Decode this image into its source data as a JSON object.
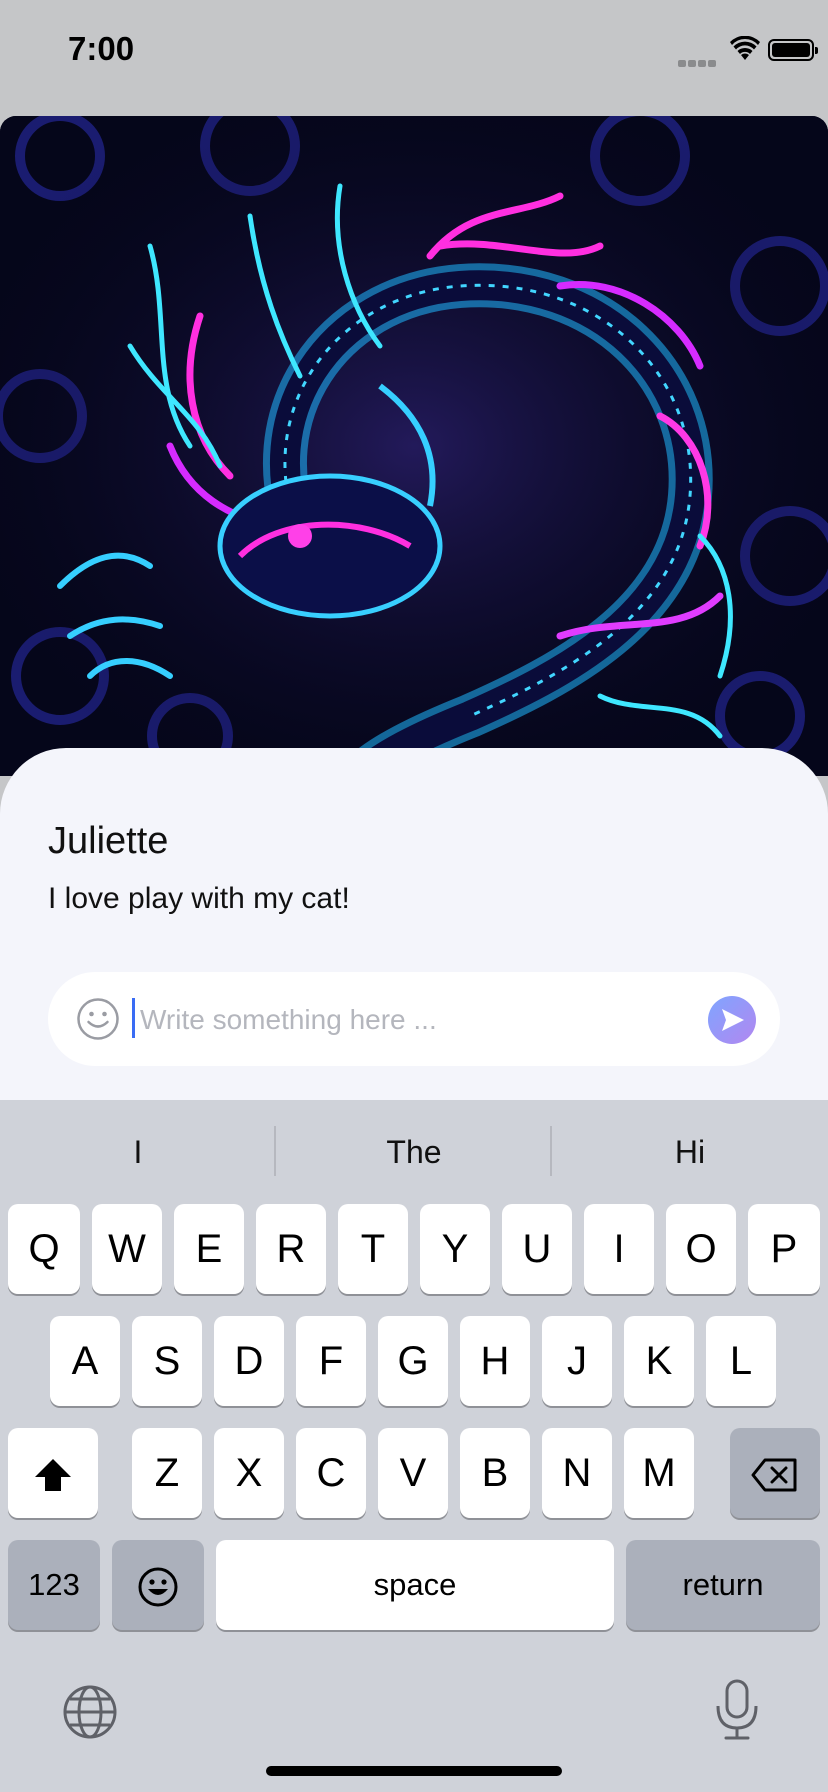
{
  "status_bar": {
    "time": "7:00"
  },
  "post": {
    "image_description_icon": "dragon-illustration",
    "user_name": "Juliette",
    "message": "I love play with my cat!"
  },
  "comment": {
    "placeholder": "Write something here ...",
    "value": ""
  },
  "keyboard": {
    "suggestions": [
      "I",
      "The",
      "Hi"
    ],
    "row1": [
      "Q",
      "W",
      "E",
      "R",
      "T",
      "Y",
      "U",
      "I",
      "O",
      "P"
    ],
    "row2": [
      "A",
      "S",
      "D",
      "F",
      "G",
      "H",
      "J",
      "K",
      "L"
    ],
    "row3": [
      "Z",
      "X",
      "C",
      "V",
      "B",
      "N",
      "M"
    ],
    "numbers_label": "123",
    "space_label": "space",
    "return_label": "return"
  },
  "colors": {
    "accent_send_gradient_start": "#7fa5ff",
    "accent_send_gradient_end": "#b287f0",
    "caret": "#3a6cf4"
  }
}
